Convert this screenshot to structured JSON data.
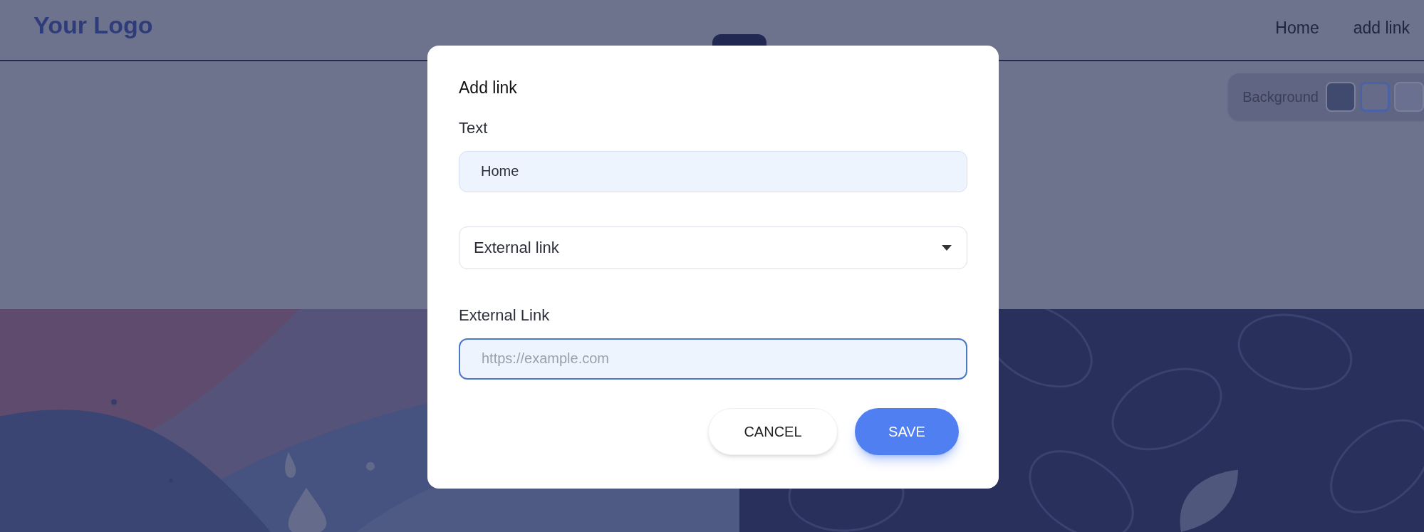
{
  "header": {
    "logo": "Your Logo",
    "nav": [
      "Home",
      "add link"
    ]
  },
  "background_picker": {
    "label": "Background",
    "swatches": [
      {
        "color": "#3f4a6e",
        "selected": false
      },
      {
        "color": "#656b88",
        "selected": true
      },
      {
        "color": "#6a7090",
        "selected": false
      }
    ]
  },
  "dialog": {
    "title": "Add link",
    "fields": [
      {
        "kind": "text",
        "label": "Text",
        "value": "Home",
        "focused": false
      },
      {
        "kind": "select",
        "value": "External link"
      },
      {
        "kind": "text",
        "label": "External Link",
        "placeholder": "https://example.com",
        "focused": true
      }
    ],
    "buttons": [
      {
        "label": "CANCEL",
        "primary": false
      },
      {
        "label": "SAVE",
        "primary": true
      }
    ]
  }
}
